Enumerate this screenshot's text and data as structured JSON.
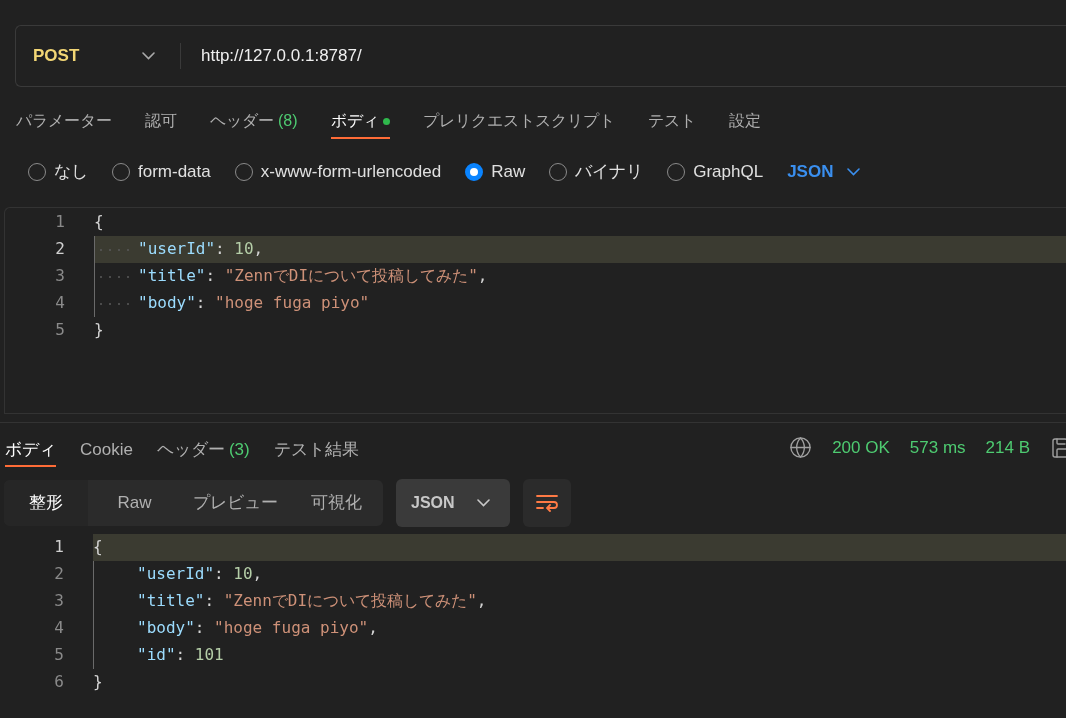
{
  "request": {
    "method": "POST",
    "url": "http://127.0.0.1:8787/"
  },
  "request_tabs": [
    {
      "label": "パラメーター",
      "selected": false
    },
    {
      "label": "認可",
      "selected": false
    },
    {
      "label": "ヘッダー",
      "count": "(8)",
      "selected": false
    },
    {
      "label": "ボディ",
      "dot": true,
      "selected": true
    },
    {
      "label": "プレリクエストスクリプト",
      "selected": false
    },
    {
      "label": "テスト",
      "selected": false
    },
    {
      "label": "設定",
      "selected": false
    }
  ],
  "body_types": [
    {
      "label": "なし",
      "selected": false
    },
    {
      "label": "form-data",
      "selected": false
    },
    {
      "label": "x-www-form-urlencoded",
      "selected": false
    },
    {
      "label": "Raw",
      "selected": true
    },
    {
      "label": "バイナリ",
      "selected": false
    },
    {
      "label": "GraphQL",
      "selected": false
    }
  ],
  "body_language": "JSON",
  "request_editor": {
    "show_whitespace": true,
    "lines": [
      {
        "number": "1",
        "indented": false,
        "highlighted": false,
        "tokens": [
          {
            "kind": "punct",
            "text": "{"
          }
        ]
      },
      {
        "number": "2",
        "indented": true,
        "highlighted": true,
        "tokens": [
          {
            "kind": "key",
            "text": "\"userId\""
          },
          {
            "kind": "punct",
            "text": ": "
          },
          {
            "kind": "number",
            "text": "10"
          },
          {
            "kind": "punct",
            "text": ","
          }
        ]
      },
      {
        "number": "3",
        "indented": true,
        "highlighted": false,
        "tokens": [
          {
            "kind": "key",
            "text": "\"title\""
          },
          {
            "kind": "punct",
            "text": ": "
          },
          {
            "kind": "string",
            "text": "\"ZennでDIについて投稿してみた\""
          },
          {
            "kind": "punct",
            "text": ","
          }
        ]
      },
      {
        "number": "4",
        "indented": true,
        "highlighted": false,
        "tokens": [
          {
            "kind": "key",
            "text": "\"body\""
          },
          {
            "kind": "punct",
            "text": ": "
          },
          {
            "kind": "string",
            "text": "\"hoge fuga piyo\""
          }
        ]
      },
      {
        "number": "5",
        "indented": false,
        "highlighted": false,
        "tokens": [
          {
            "kind": "punct",
            "text": "}"
          }
        ]
      }
    ]
  },
  "response_tabs": [
    {
      "label": "ボディ",
      "selected": true
    },
    {
      "label": "Cookie",
      "selected": false
    },
    {
      "label": "ヘッダー",
      "count": "(3)",
      "selected": false
    },
    {
      "label": "テスト結果",
      "selected": false
    }
  ],
  "response_status": {
    "status": "200 OK",
    "time": "573 ms",
    "size": "214 B"
  },
  "view_modes": [
    {
      "label": "整形",
      "selected": true
    },
    {
      "label": "Raw",
      "selected": false
    },
    {
      "label": "プレビュー",
      "selected": false
    },
    {
      "label": "可視化",
      "selected": false
    }
  ],
  "response_format": "JSON",
  "response_editor": {
    "show_whitespace": false,
    "lines": [
      {
        "number": "1",
        "indented": false,
        "highlighted": true,
        "tokens": [
          {
            "kind": "punct",
            "text": "{"
          }
        ]
      },
      {
        "number": "2",
        "indented": true,
        "highlighted": false,
        "tokens": [
          {
            "kind": "key",
            "text": "\"userId\""
          },
          {
            "kind": "punct",
            "text": ": "
          },
          {
            "kind": "number",
            "text": "10"
          },
          {
            "kind": "punct",
            "text": ","
          }
        ]
      },
      {
        "number": "3",
        "indented": true,
        "highlighted": false,
        "tokens": [
          {
            "kind": "key",
            "text": "\"title\""
          },
          {
            "kind": "punct",
            "text": ": "
          },
          {
            "kind": "string",
            "text": "\"ZennでDIについて投稿してみた\""
          },
          {
            "kind": "punct",
            "text": ","
          }
        ]
      },
      {
        "number": "4",
        "indented": true,
        "highlighted": false,
        "tokens": [
          {
            "kind": "key",
            "text": "\"body\""
          },
          {
            "kind": "punct",
            "text": ": "
          },
          {
            "kind": "string",
            "text": "\"hoge fuga piyo\""
          },
          {
            "kind": "punct",
            "text": ","
          }
        ]
      },
      {
        "number": "5",
        "indented": true,
        "highlighted": false,
        "tokens": [
          {
            "kind": "key",
            "text": "\"id\""
          },
          {
            "kind": "punct",
            "text": ": "
          },
          {
            "kind": "number",
            "text": "101"
          }
        ]
      },
      {
        "number": "6",
        "indented": false,
        "highlighted": false,
        "tokens": [
          {
            "kind": "punct",
            "text": "}"
          }
        ]
      }
    ]
  }
}
